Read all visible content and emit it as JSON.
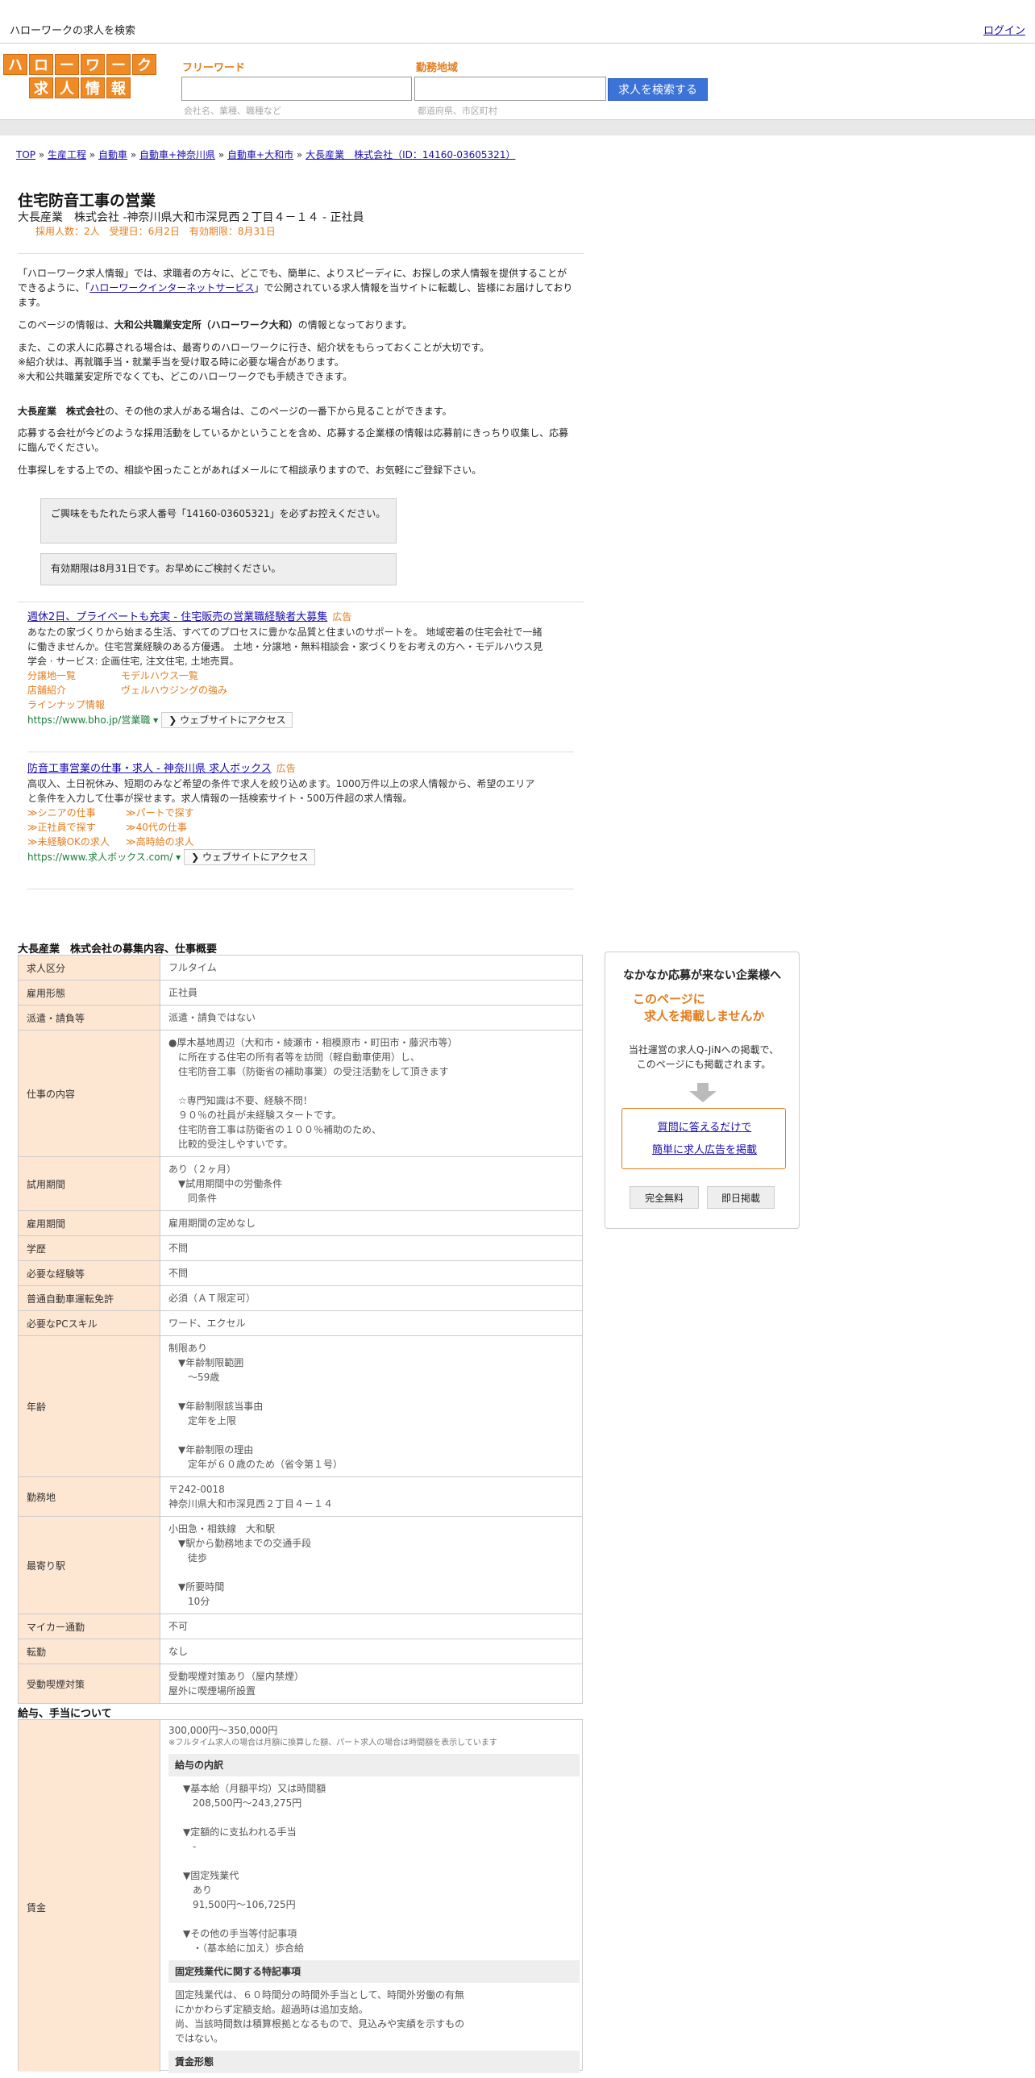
{
  "topbar": {
    "title": "ハローワークの求人を検索",
    "login": "ログイン"
  },
  "logo": {
    "row1": [
      "ハ",
      "ロ",
      "ー",
      "ワ",
      "ー",
      "ク"
    ],
    "row2": [
      "求",
      "人",
      "情",
      "報"
    ]
  },
  "search": {
    "keyword_label": "フリーワード",
    "keyword_placeholder": "会社名、業種、職種など",
    "area_label": "勤務地域",
    "area_placeholder": "都道府県、市区町村",
    "button": "求人を検索する"
  },
  "breadcrumb": [
    "TOP",
    "生産工程",
    "自動車",
    "自動車+神奈川県",
    "自動車+大和市",
    "大長産業　株式会社（ID：14160-03605321）"
  ],
  "job": {
    "title": "住宅防音工事の営業",
    "company": "大長産業　株式会社 -神奈川県大和市深見西２丁目４－１４ - 正社員",
    "meta": "採用人数：2人　受理日：6月2日　有効期限：8月31日"
  },
  "intro": {
    "p1_a": "「ハローワーク求人情報」では、求職者の方々に、どこでも、簡単に、よりスピーディに、お探しの求人情報を提供することができるように、「",
    "p1_link": "ハローワークインターネットサービス",
    "p1_b": "」で公開されている求人情報を当サイトに転載し、皆様にお届けしております。",
    "p2_a": "このページの情報は、",
    "p2_b": "大和公共職業安定所（ハローワーク大和）",
    "p2_c": "の情報となっております。",
    "p3_1": "また、この求人に応募される場合は、最寄りのハローワークに行き、紹介状をもらっておくことが大切です。",
    "p3_2": "※紹介状は、再就職手当・就業手当を受け取る時に必要な場合があります。",
    "p3_3": "※大和公共職業安定所でなくても、どこのハローワークでも手続きできます。",
    "p4_a": "大長産業　株式会社",
    "p4_b": "の、その他の求人がある場合は、このページの一番下から見ることができます。",
    "p5": "応募する会社が今どのような採用活動をしているかということを含め、応募する企業様の情報は応募前にきっちり収集し、応募に臨んでください。",
    "p6": "仕事探しをする上での、相談や困ったことがあればメールにて相談承りますので、お気軽にご登録下さい。"
  },
  "notes": [
    "ご興味をもたれたら求人番号「14160-03605321」を必ずお控えください。",
    "有効期限は8月31日です。お早めにご検討ください。"
  ],
  "ads": [
    {
      "title": "週休2日、プライベートも充実 - 住宅販売の営業職経験者大募集",
      "tag": "広告",
      "text": "あなたの家づくりから始まる生活、すべてのプロセスに豊かな品質と住まいのサポートを。 地域密着の住宅会社で一緒に働きませんか。住宅営業経験のある方優遇。 土地・分譲地・無料相談会・家づくりをお考えの方へ・モデルハウス見学会 · サービス: 企画住宅, 注文住宅, 土地売買。",
      "links": [
        [
          "分譲地一覧",
          "モデルハウス一覧"
        ],
        [
          "店舗紹介",
          "ヴェルハウジングの強み"
        ],
        [
          "ラインナップ情報"
        ]
      ],
      "url": "https://www.bho.jp/営業職",
      "button": "ウェブサイトにアクセス"
    },
    {
      "title": "防音工事営業の仕事・求人 - 神奈川県 求人ボックス",
      "tag": "広告",
      "text": "高収入、土日祝休み、短期のみなど希望の条件で求人を絞り込めます。1000万件以上の求人情報から、希望のエリアと条件を入力して仕事が探せます。求人情報の一括検索サイト・500万件超の求人情報。",
      "links": [
        [
          "≫シニアの仕事",
          "≫パートで探す"
        ],
        [
          "≫正社員で探す",
          "≫40代の仕事"
        ],
        [
          "≫未経験OKの求人",
          "≫高時給の求人"
        ]
      ],
      "url": "https://www.求人ボックス.com/",
      "button": "ウェブサイトにアクセス"
    }
  ],
  "overview": {
    "title": "大長産業　株式会社の募集内容、仕事概要",
    "rows": [
      {
        "label": "求人区分",
        "value": [
          "フルタイム"
        ]
      },
      {
        "label": "雇用形態",
        "value": [
          "正社員"
        ]
      },
      {
        "label": "派遣・請負等",
        "value": [
          "派遣・請負ではない"
        ]
      },
      {
        "label": "仕事の内容",
        "value": [
          "●厚木基地周辺（大和市・綾瀬市・相模原市・町田市・藤沢市等）",
          "　に所在する住宅の所有者等を訪問（軽自動車使用）し、",
          "　住宅防音工事（防衛省の補助事業）の受注活動をして頂きます",
          "",
          "　☆専門知識は不要、経験不問！",
          "　９０％の社員が未経験スタートです。",
          "　住宅防音工事は防衛省の１００％補助のため、",
          "　比較的受注しやすいです。"
        ]
      },
      {
        "label": "試用期間",
        "value": [
          "あり（２ヶ月）",
          "　▼試用期間中の労働条件",
          "　　同条件"
        ]
      },
      {
        "label": "雇用期間",
        "value": [
          "雇用期間の定めなし"
        ]
      },
      {
        "label": "学歴",
        "value": [
          "不問"
        ]
      },
      {
        "label": "必要な経験等",
        "value": [
          "不問"
        ]
      },
      {
        "label": "普通自動車運転免許",
        "value": [
          "必須（ＡＴ限定可）"
        ]
      },
      {
        "label": "必要なPCスキル",
        "value": [
          "ワード、エクセル"
        ]
      },
      {
        "label": "年齢",
        "value": [
          "制限あり",
          "　▼年齢制限範囲",
          "　　〜59歳",
          "",
          "　▼年齢制限該当事由",
          "　　定年を上限",
          "",
          "　▼年齢制限の理由",
          "　　定年が６０歳のため（省令第１号）"
        ]
      },
      {
        "label": "勤務地",
        "value": [
          "〒242-0018",
          "神奈川県大和市深見西２丁目４－１４"
        ]
      },
      {
        "label": "最寄り駅",
        "value": [
          "小田急・相鉄線　大和駅",
          "　▼駅から勤務地までの交通手段",
          "　　徒歩",
          "",
          "　▼所要時間",
          "　　10分"
        ]
      },
      {
        "label": "マイカー通勤",
        "value": [
          "不可"
        ]
      },
      {
        "label": "転勤",
        "value": [
          "なし"
        ]
      },
      {
        "label": "受動喫煙対策",
        "value": [
          "受動喫煙対策あり（屋内禁煙）",
          "屋外に喫煙場所設置"
        ]
      }
    ]
  },
  "sidebar": {
    "title": "なかなか応募が来ない企業様へ",
    "offer1": "このページに",
    "offer2": "求人を掲載しませんか",
    "desc1": "当社運営の求人Q-JiNへの掲載で、",
    "desc2": "このページにも掲載されます。",
    "link1": "質問に答えるだけで",
    "link2": "簡単に求人広告を掲載",
    "btn1": "完全無料",
    "btn2": "即日掲載"
  },
  "wage": {
    "title": "給与、手当について",
    "label": "賃金",
    "amount": "300,000円〜350,000円",
    "note": "※フルタイム求人の場合は月額に換算した額、パート求人の場合は時間額を表示しています",
    "breakdown_title": "給与の内訳",
    "breakdown": [
      "▼基本給（月額平均）又は時間額",
      "　208,500円〜243,275円",
      "",
      "▼定額的に支払われる手当",
      "　-",
      "",
      "▼固定残業代",
      "　あり",
      "　91,500円〜106,725円",
      "",
      "▼その他の手当等付記事項",
      "　・（基本給に加え）歩合給"
    ],
    "fixed_title": "固定残業代に関する特記事項",
    "fixed": [
      "固定残業代は、６０時間分の時間外手当として、時間外労働の有無",
      "にかかわらず定額支給。超過時は追加支給。",
      "尚、当該時間数は積算根拠となるもので、見込みや実績を示すもの",
      "ではない。"
    ],
    "form_title": "賃金形態"
  }
}
